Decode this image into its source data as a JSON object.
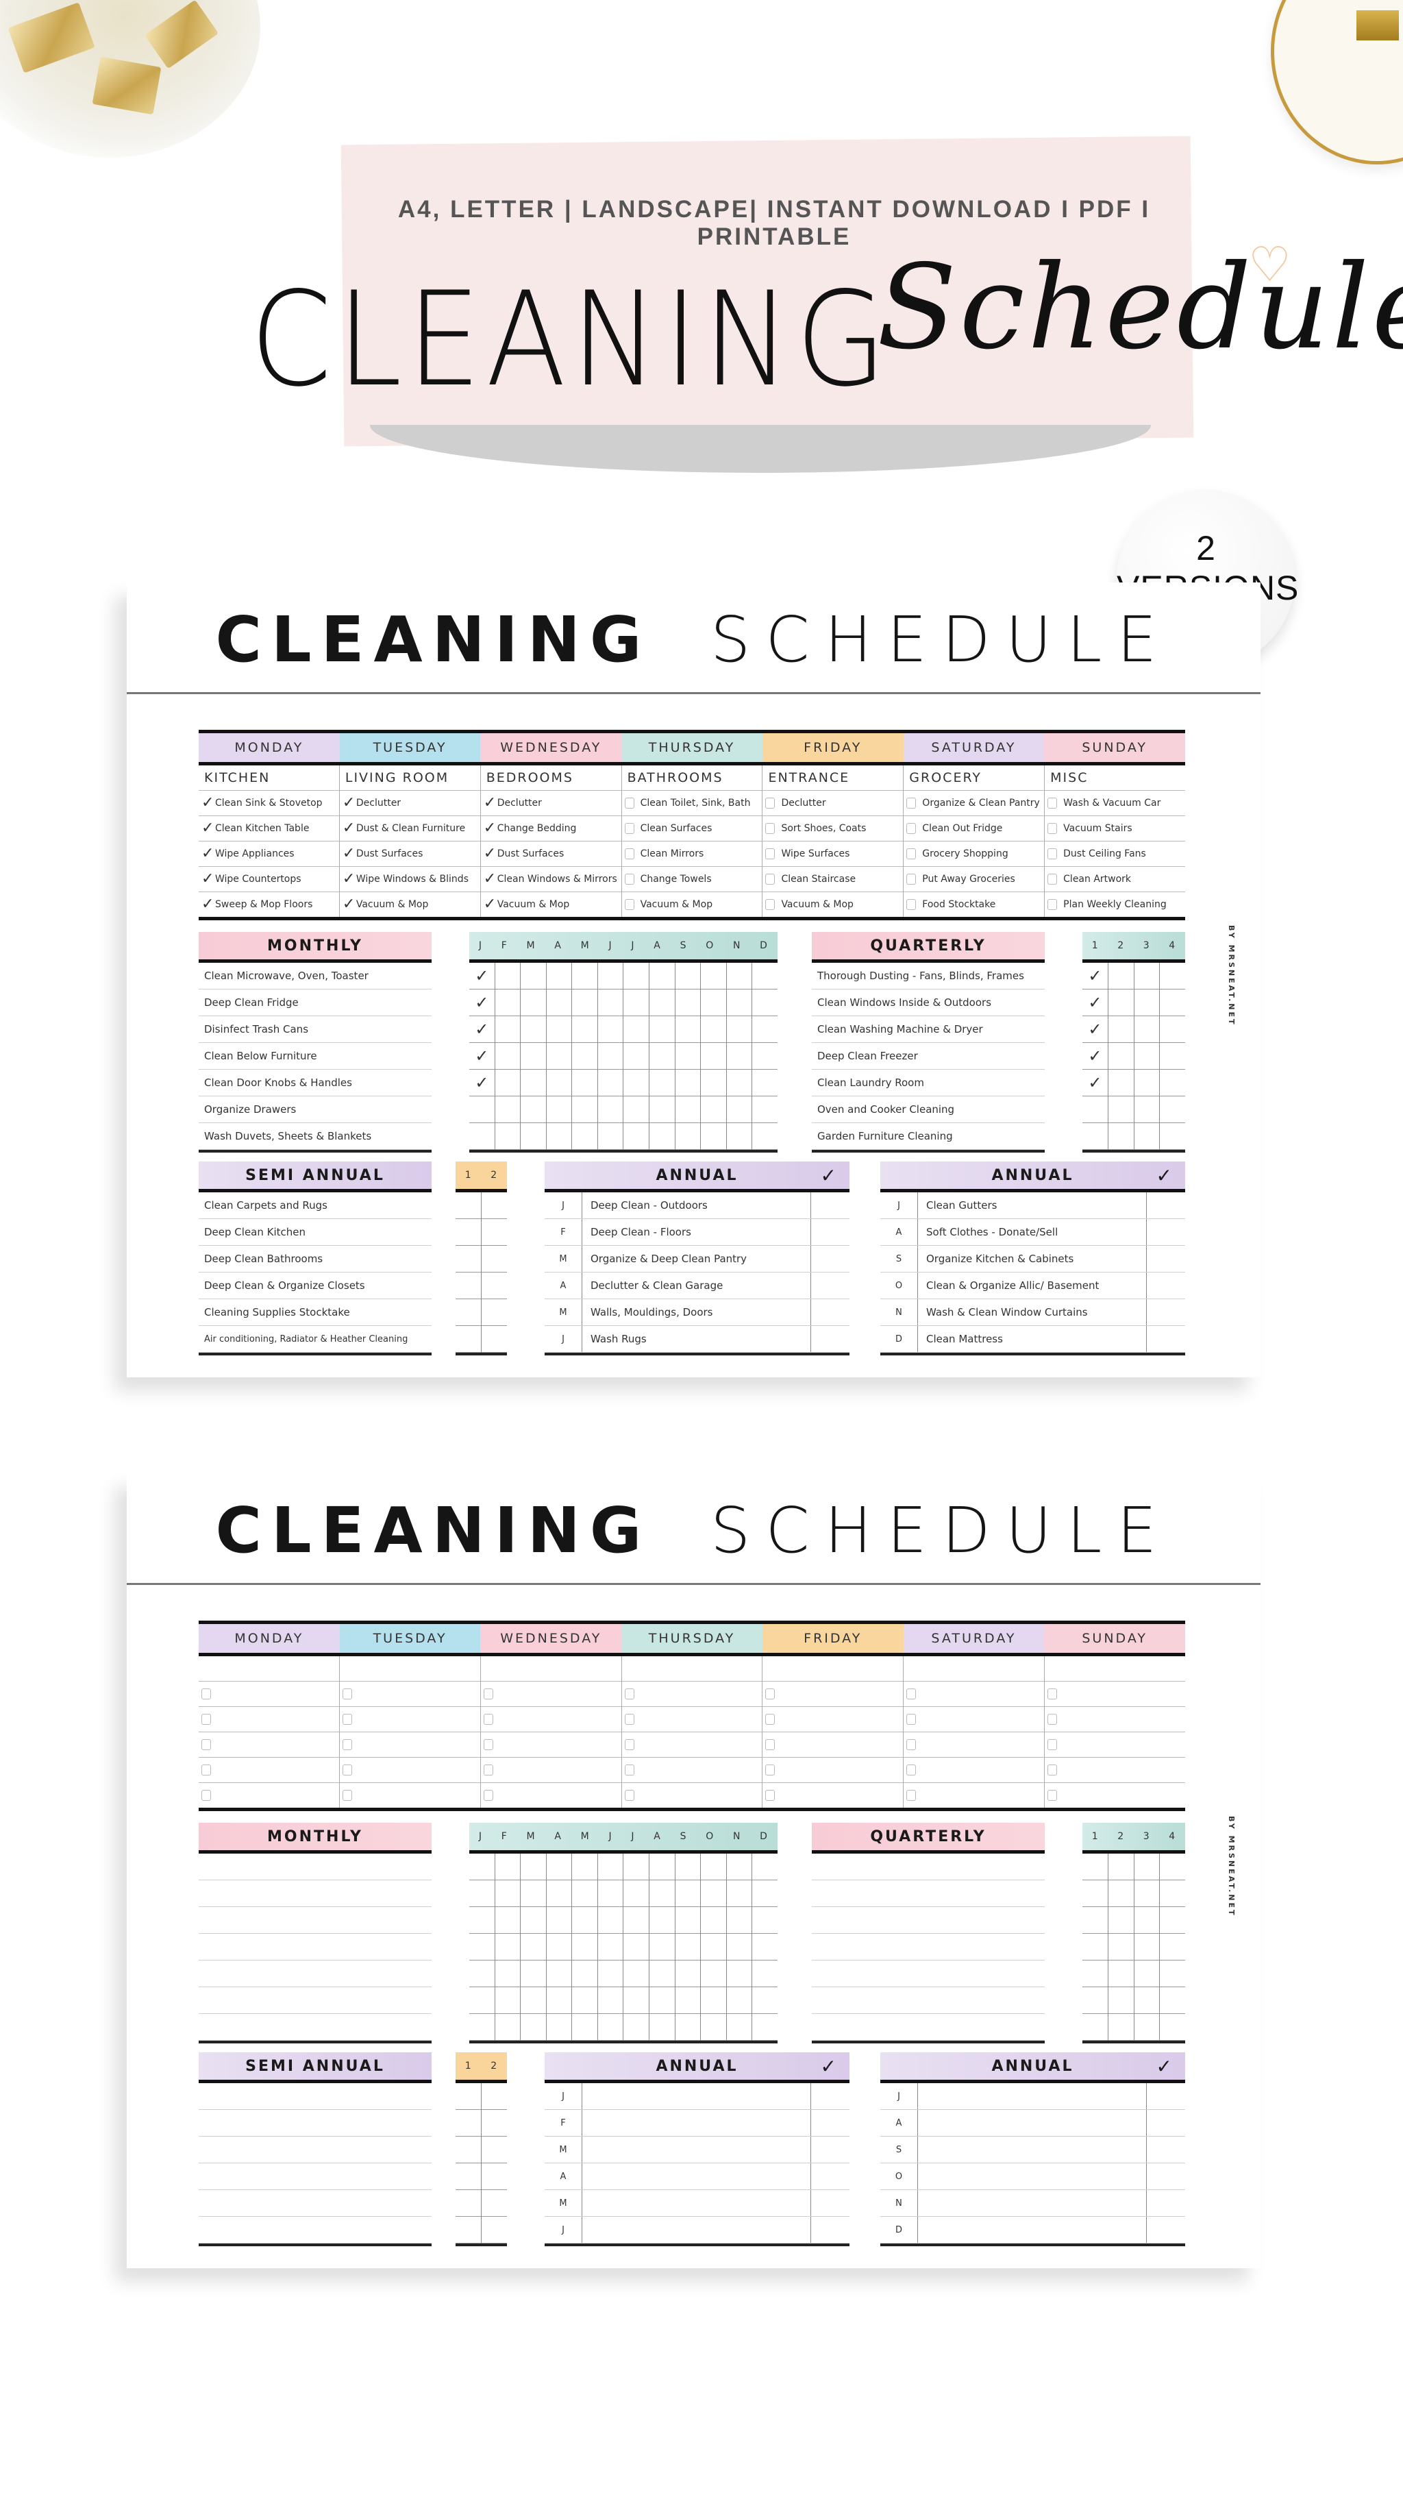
{
  "banner": {
    "tagline": "A4, LETTER | LANDSCAPE| INSTANT DOWNLOAD I PDF I PRINTABLE",
    "title_main": "CLEANING",
    "title_script": "Schedule",
    "versions_badge": {
      "count": "2",
      "label": "VERSIONS"
    }
  },
  "sheet_title": {
    "bold": "CLEANING",
    "light": "SCHEDULE"
  },
  "credit": "BY MRSNEAT.NET",
  "colors": {
    "monday": "#e3d8ef",
    "tuesday": "#b5e0ee",
    "wednesday": "#f9cfd9",
    "thursday": "#c9e7e2",
    "friday": "#f9d69e",
    "saturday": "#e3d8ef",
    "sunday": "#f8d2da"
  },
  "days": [
    "MONDAY",
    "TUESDAY",
    "WEDNESDAY",
    "THURSDAY",
    "FRIDAY",
    "SATURDAY",
    "SUNDAY"
  ],
  "filled": {
    "weekly": [
      {
        "area": "KITCHEN",
        "tasks": [
          {
            "text": "Clean Sink & Stovetop",
            "done": true
          },
          {
            "text": "Clean Kitchen Table",
            "done": true
          },
          {
            "text": "Wipe Appliances",
            "done": true
          },
          {
            "text": "Wipe Countertops",
            "done": true
          },
          {
            "text": "Sweep & Mop Floors",
            "done": true
          }
        ]
      },
      {
        "area": "LIVING ROOM",
        "tasks": [
          {
            "text": "Declutter",
            "done": true
          },
          {
            "text": "Dust & Clean Furniture",
            "done": true
          },
          {
            "text": "Dust Surfaces",
            "done": true
          },
          {
            "text": "Wipe Windows & Blinds",
            "done": true
          },
          {
            "text": "Vacuum & Mop",
            "done": true
          }
        ]
      },
      {
        "area": "BEDROOMS",
        "tasks": [
          {
            "text": "Declutter",
            "done": true
          },
          {
            "text": "Change Bedding",
            "done": true
          },
          {
            "text": "Dust Surfaces",
            "done": true
          },
          {
            "text": "Clean Windows & Mirrors",
            "done": true
          },
          {
            "text": "Vacuum & Mop",
            "done": true
          }
        ]
      },
      {
        "area": "BATHROOMS",
        "tasks": [
          {
            "text": "Clean Toilet, Sink, Bath",
            "done": false
          },
          {
            "text": "Clean Surfaces",
            "done": false
          },
          {
            "text": "Clean Mirrors",
            "done": false
          },
          {
            "text": "Change Towels",
            "done": false
          },
          {
            "text": "Vacuum & Mop",
            "done": false
          }
        ]
      },
      {
        "area": "ENTRANCE",
        "tasks": [
          {
            "text": "Declutter",
            "done": false
          },
          {
            "text": "Sort Shoes, Coats",
            "done": false
          },
          {
            "text": "Wipe Surfaces",
            "done": false
          },
          {
            "text": "Clean Staircase",
            "done": false
          },
          {
            "text": "Vacuum & Mop",
            "done": false
          }
        ]
      },
      {
        "area": "GROCERY",
        "tasks": [
          {
            "text": "Organize & Clean Pantry",
            "done": false
          },
          {
            "text": "Clean Out Fridge",
            "done": false
          },
          {
            "text": "Grocery Shopping",
            "done": false
          },
          {
            "text": "Put Away Groceries",
            "done": false
          },
          {
            "text": "Food Stocktake",
            "done": false
          }
        ]
      },
      {
        "area": "MISC",
        "tasks": [
          {
            "text": "Wash & Vacuum Car",
            "done": false
          },
          {
            "text": "Vacuum Stairs",
            "done": false
          },
          {
            "text": "Dust Ceiling Fans",
            "done": false
          },
          {
            "text": "Clean Artwork",
            "done": false
          },
          {
            "text": "Plan Weekly Cleaning",
            "done": false
          }
        ]
      }
    ],
    "monthly": {
      "title": "MONTHLY",
      "months": [
        "J",
        "F",
        "M",
        "A",
        "M",
        "J",
        "J",
        "A",
        "S",
        "O",
        "N",
        "D"
      ],
      "tasks": [
        "Clean Microwave, Oven, Toaster",
        "Deep Clean Fridge",
        "Disinfect Trash Cans",
        "Clean Below Furniture",
        "Clean Door Knobs & Handles",
        "Organize Drawers",
        "Wash Duvets, Sheets & Blankets"
      ],
      "checked_first_month": [
        true,
        true,
        true,
        true,
        true,
        false,
        false
      ]
    },
    "quarterly": {
      "title": "QUARTERLY",
      "quarters": [
        "1",
        "2",
        "3",
        "4"
      ],
      "tasks": [
        "Thorough Dusting - Fans, Blinds, Frames",
        "Clean Windows Inside & Outdoors",
        "Clean Washing Machine & Dryer",
        "Deep Clean Freezer",
        "Clean Laundry Room",
        "Oven and Cooker Cleaning",
        "Garden Furniture Cleaning"
      ],
      "checked_first_quarter": [
        true,
        true,
        true,
        true,
        true,
        false,
        false
      ]
    },
    "semi_annual": {
      "title": "SEMI ANNUAL",
      "halves": [
        "1",
        "2"
      ],
      "tasks": [
        "Clean Carpets and Rugs",
        "Deep Clean Kitchen",
        "Deep Clean Bathrooms",
        "Deep Clean & Organize Closets",
        "Cleaning Supplies Stocktake",
        "Air conditioning, Radiator & Heather Cleaning"
      ]
    },
    "annual_1": {
      "title": "ANNUAL",
      "check": "✓",
      "rows": [
        {
          "m": "J",
          "t": "Deep Clean - Outdoors"
        },
        {
          "m": "F",
          "t": "Deep Clean - Floors"
        },
        {
          "m": "M",
          "t": "Organize & Deep Clean Pantry"
        },
        {
          "m": "A",
          "t": "Declutter & Clean Garage"
        },
        {
          "m": "M",
          "t": "Walls, Mouldings, Doors"
        },
        {
          "m": "J",
          "t": "Wash Rugs"
        }
      ]
    },
    "annual_2": {
      "title": "ANNUAL",
      "check": "✓",
      "rows": [
        {
          "m": "J",
          "t": "Clean Gutters"
        },
        {
          "m": "A",
          "t": "Soft Clothes - Donate/Sell"
        },
        {
          "m": "S",
          "t": "Organize Kitchen & Cabinets"
        },
        {
          "m": "O",
          "t": "Clean & Organize Allic/ Basement"
        },
        {
          "m": "N",
          "t": "Wash & Clean Window Curtains"
        },
        {
          "m": "D",
          "t": "Clean Mattress"
        }
      ]
    }
  },
  "blank": {
    "monthly_title": "MONTHLY",
    "quarterly_title": "QUARTERLY",
    "semi_annual_title": "SEMI ANNUAL",
    "annual_1": {
      "title": "ANNUAL",
      "check": "✓",
      "months": [
        "J",
        "F",
        "M",
        "A",
        "M",
        "J"
      ]
    },
    "annual_2": {
      "title": "ANNUAL",
      "check": "✓",
      "months": [
        "J",
        "A",
        "S",
        "O",
        "N",
        "D"
      ]
    }
  }
}
